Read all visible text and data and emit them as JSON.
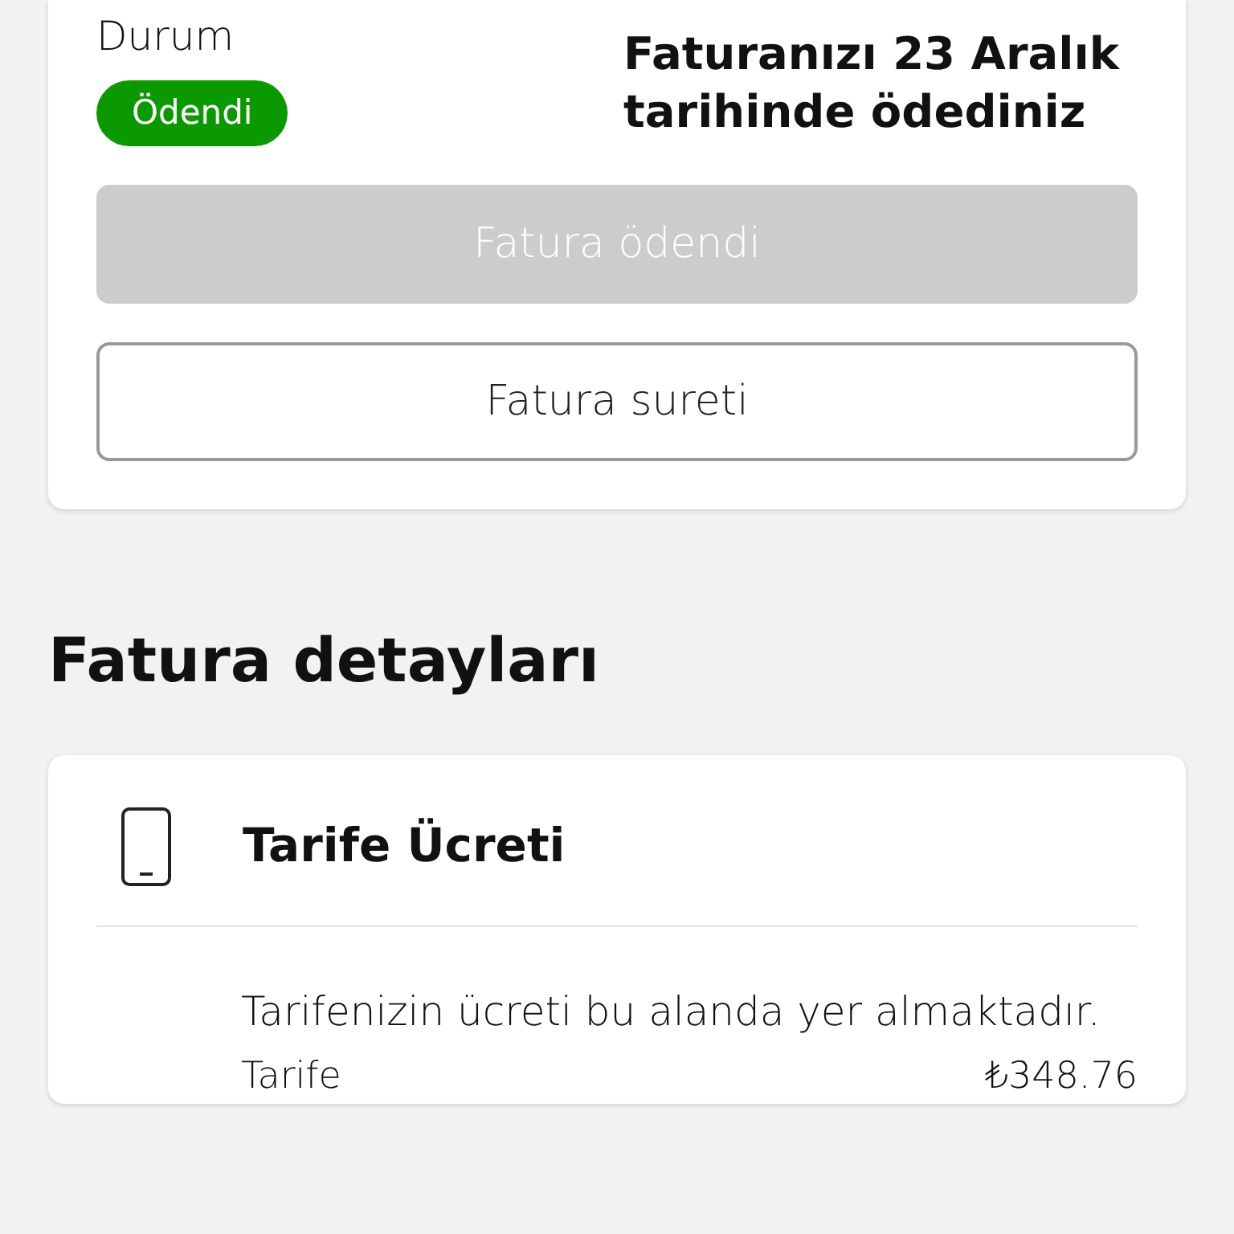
{
  "status_card": {
    "label": "Durum",
    "badge": {
      "text": "Ödendi",
      "color": "#0a9a00"
    },
    "message": "Faturanızı 23 Aralık tarihinde ödediniz",
    "buttons": [
      {
        "label": "Fatura ödendi",
        "disabled": true
      },
      {
        "label": "Fatura sureti",
        "disabled": false
      }
    ]
  },
  "section_title": "Fatura detayları",
  "detail_card": {
    "title": "Tarife Ücreti",
    "description": "Tarifenizin ücreti bu alanda yer almaktadır.",
    "rows": [
      {
        "label": "Tarife",
        "value": "₺348.76"
      }
    ]
  }
}
